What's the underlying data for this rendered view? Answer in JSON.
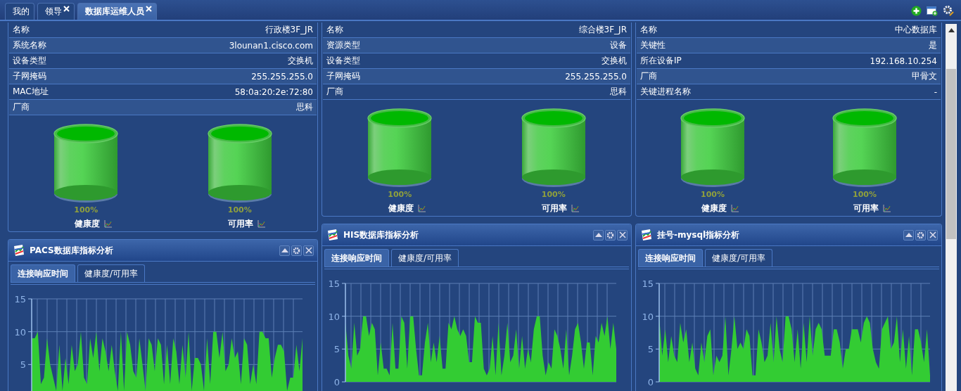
{
  "tabs": [
    {
      "label": "我的",
      "selected": false,
      "closable": false
    },
    {
      "label": "领导",
      "selected": false,
      "closable": true
    },
    {
      "label": "数据库运维人员",
      "selected": true,
      "closable": true
    }
  ],
  "columns": [
    {
      "card": {
        "rows": [
          {
            "label": "名称",
            "value": "行政楼3F_JR"
          },
          {
            "label": "系统名称",
            "value": "3lounan1.cisco.com"
          },
          {
            "label": "设备类型",
            "value": "交换机"
          },
          {
            "label": "子网掩码",
            "value": "255.255.255.0"
          },
          {
            "label": "MAC地址",
            "value": "58:0a:20:2e:72:80"
          },
          {
            "label": "厂商",
            "value": "思科"
          }
        ],
        "gauges": [
          {
            "label": "健康度",
            "reading": "100%"
          },
          {
            "label": "可用率",
            "reading": "100%"
          }
        ]
      },
      "panel": {
        "title": "PACS数据库指标分析",
        "tabs": [
          {
            "label": "连接响应时间",
            "selected": true
          },
          {
            "label": "健康度/可用率",
            "selected": false
          }
        ],
        "chart_data": {
          "type": "area",
          "grid": true,
          "ylim": [
            0,
            15
          ],
          "yticks": [
            5,
            10,
            15
          ],
          "series": [
            {
              "color": "#33cc33",
              "values": [
                9,
                9,
                10,
                2,
                3,
                9,
                5,
                3,
                1,
                8,
                1,
                6,
                2,
                8,
                4,
                5,
                10,
                3,
                2,
                9,
                6,
                10,
                4,
                9,
                7,
                4,
                8,
                4,
                1,
                10,
                1,
                10,
                8,
                4,
                3,
                9,
                5,
                1,
                9,
                8,
                4,
                9,
                8,
                2,
                8,
                2,
                9,
                7,
                2,
                8,
                3,
                10,
                1,
                6,
                6,
                5,
                1,
                9,
                2,
                10,
                10,
                6,
                10,
                4,
                5,
                9,
                6,
                7,
                2,
                9,
                8,
                2,
                5,
                2,
                10,
                10,
                9,
                9,
                3,
                6,
                8,
                8,
                7,
                1,
                3,
                3,
                8,
                4,
                9
              ]
            }
          ]
        }
      }
    },
    {
      "card": {
        "rows": [
          {
            "label": "名称",
            "value": "综合楼3F_JR"
          },
          {
            "label": "资源类型",
            "value": "设备"
          },
          {
            "label": "设备类型",
            "value": "交换机"
          },
          {
            "label": "子网掩码",
            "value": "255.255.255.0"
          },
          {
            "label": "厂商",
            "value": "思科"
          }
        ],
        "gauges": [
          {
            "label": "健康度",
            "reading": "100%"
          },
          {
            "label": "可用率",
            "reading": "100%"
          }
        ]
      },
      "panel": {
        "title": "HIS数据库指标分析",
        "tabs": [
          {
            "label": "连接响应时间",
            "selected": true
          },
          {
            "label": "健康度/可用率",
            "selected": false
          }
        ],
        "chart_data": {
          "type": "area",
          "grid": true,
          "ylim": [
            0,
            15
          ],
          "yticks": [
            0,
            5,
            10,
            15
          ],
          "series": [
            {
              "color": "#33cc33",
              "values": [
                9,
                4,
                2,
                9,
                4,
                5,
                10,
                10,
                7,
                9,
                8,
                1,
                6,
                2,
                2,
                1,
                9,
                2,
                2,
                10,
                9,
                2,
                10,
                10,
                5,
                1,
                1,
                6,
                9,
                3,
                6,
                3,
                7,
                2,
                2,
                9,
                8,
                10,
                8,
                7,
                8,
                7,
                3,
                3,
                10,
                9,
                9,
                2,
                1,
                2,
                7,
                1,
                9,
                1,
                4,
                9,
                3,
                4,
                8,
                2,
                7,
                2,
                5,
                3,
                8,
                10,
                10,
                4,
                1,
                3,
                2,
                8,
                7,
                5,
                2,
                8,
                1,
                4,
                8,
                9,
                6,
                2,
                6,
                6,
                1,
                7,
                6,
                9,
                7,
                10,
                5,
                9,
                5
              ]
            }
          ]
        }
      }
    },
    {
      "card": {
        "rows": [
          {
            "label": "名称",
            "value": "中心数据库"
          },
          {
            "label": "关键性",
            "value": "是"
          },
          {
            "label": "所在设备IP",
            "value": "192.168.10.254"
          },
          {
            "label": "厂商",
            "value": "甲骨文"
          },
          {
            "label": "关键进程名称",
            "value": "-"
          }
        ],
        "gauges": [
          {
            "label": "健康度",
            "reading": "100%"
          },
          {
            "label": "可用率",
            "reading": "100%"
          }
        ]
      },
      "panel": {
        "title": "挂号-mysql指标分析",
        "tabs": [
          {
            "label": "连接响应时间",
            "selected": true
          },
          {
            "label": "健康度/可用率",
            "selected": false
          }
        ],
        "chart_data": {
          "type": "area",
          "grid": true,
          "ylim": [
            0,
            15
          ],
          "yticks": [
            0,
            5,
            10,
            15
          ],
          "series": [
            {
              "color": "#33cc33",
              "values": [
                10,
                4,
                8,
                3,
                7,
                4,
                3,
                9,
                6,
                8,
                3,
                6,
                2,
                1,
                6,
                3,
                7,
                8,
                1,
                4,
                3,
                4,
                10,
                1,
                5,
                10,
                5,
                6,
                5,
                8,
                7,
                1,
                1,
                8,
                6,
                3,
                4,
                9,
                3,
                10,
                5,
                3,
                10,
                10,
                8,
                3,
                8,
                2,
                9,
                3,
                10,
                4,
                8,
                9,
                8,
                4,
                4,
                4,
                8,
                8,
                6,
                2,
                5,
                5,
                8,
                8,
                8,
                6,
                9,
                10,
                9,
                5,
                3,
                2,
                8,
                9,
                10,
                5,
                6,
                10,
                3,
                8,
                2,
                7,
                1,
                8,
                8,
                6,
                3,
                8,
                1
              ]
            }
          ]
        }
      }
    }
  ]
}
